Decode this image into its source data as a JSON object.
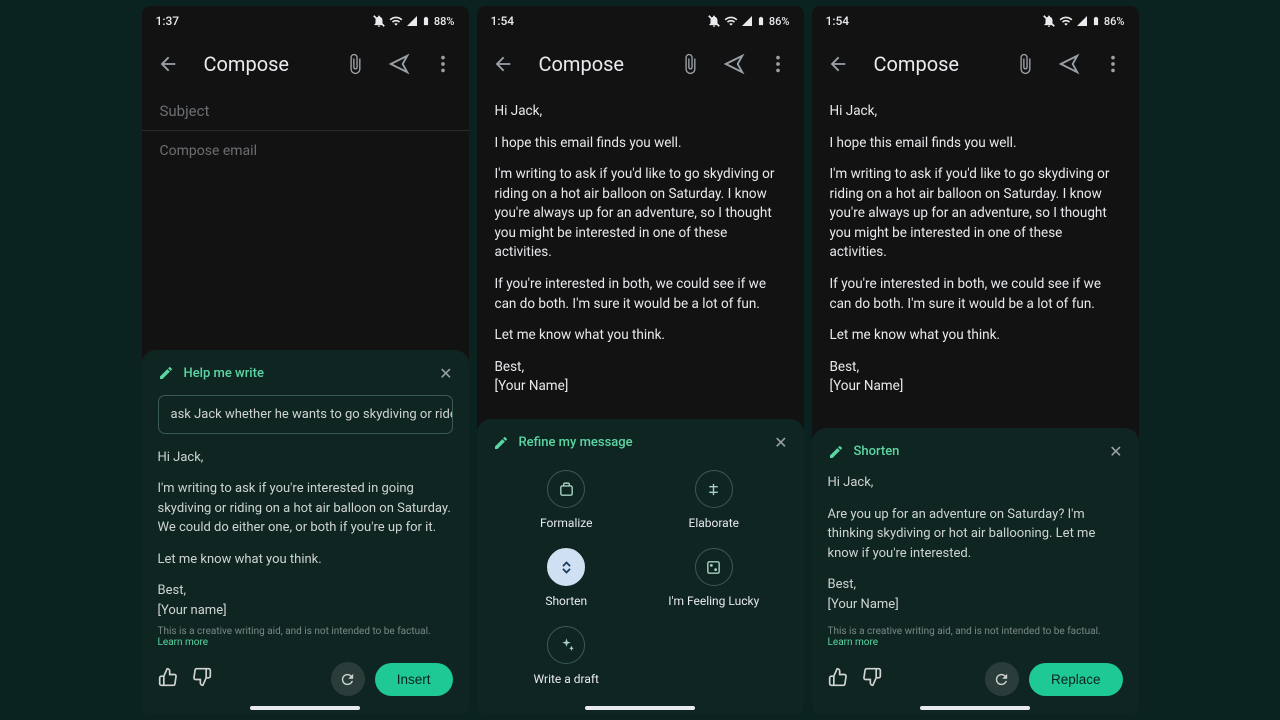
{
  "screens": [
    {
      "status": {
        "time": "1:37",
        "battery": "88%"
      },
      "title": "Compose",
      "subject_placeholder": "Subject",
      "body_placeholder": "Compose email",
      "panel": {
        "heading": "Help me write",
        "prompt": "ask Jack whether he wants to go skydiving or ride on a",
        "para1": "Hi Jack,",
        "para2": "I'm writing to ask if you're interested in going skydiving or riding on a hot air balloon on Saturday. We could do either one, or both if you're up for it.",
        "para3": "Let me know what you think.",
        "para4": "Best,",
        "para5": "[Your name]",
        "disclaimer": "This is a creative writing aid, and is not intended to be factual.",
        "learn": "Learn more",
        "insert": "Insert"
      }
    },
    {
      "status": {
        "time": "1:54",
        "battery": "86%"
      },
      "title": "Compose",
      "body": {
        "p1": "Hi Jack,",
        "p2": "I hope this email finds you well.",
        "p3": "I'm writing to ask if you'd like to go skydiving or riding on a hot air balloon on Saturday. I know you're always up for an adventure, so I thought you might be interested in one of these activities.",
        "p4": "If you're interested in both, we could see if we can do both. I'm sure it would be a lot of fun.",
        "p5": "Let me know what you think.",
        "p6": "Best,",
        "p7": "[Your Name]"
      },
      "panel": {
        "heading": "Refine my message",
        "opt1": "Formalize",
        "opt2": "Elaborate",
        "opt3": "Shorten",
        "opt4": "I'm Feeling Lucky",
        "opt5": "Write a draft"
      }
    },
    {
      "status": {
        "time": "1:54",
        "battery": "86%"
      },
      "title": "Compose",
      "body": {
        "p1": "Hi Jack,",
        "p2": "I hope this email finds you well.",
        "p3": "I'm writing to ask if you'd like to go skydiving or riding on a hot air balloon on Saturday. I know you're always up for an adventure, so I thought you might be interested in one of these activities.",
        "p4": "If you're interested in both, we could see if we can do both. I'm sure it would be a lot of fun.",
        "p5": "Let me know what you think.",
        "p6": "Best,",
        "p7": "[Your Name]"
      },
      "panel": {
        "heading": "Shorten",
        "para1": "Hi Jack,",
        "para2": "Are you up for an adventure on Saturday? I'm thinking skydiving or hot air ballooning. Let me know if you're interested.",
        "para3": "Best,",
        "para4": "[Your Name]",
        "disclaimer": "This is a creative writing aid, and is not intended to be factual.",
        "learn": "Learn more",
        "replace": "Replace"
      }
    }
  ]
}
